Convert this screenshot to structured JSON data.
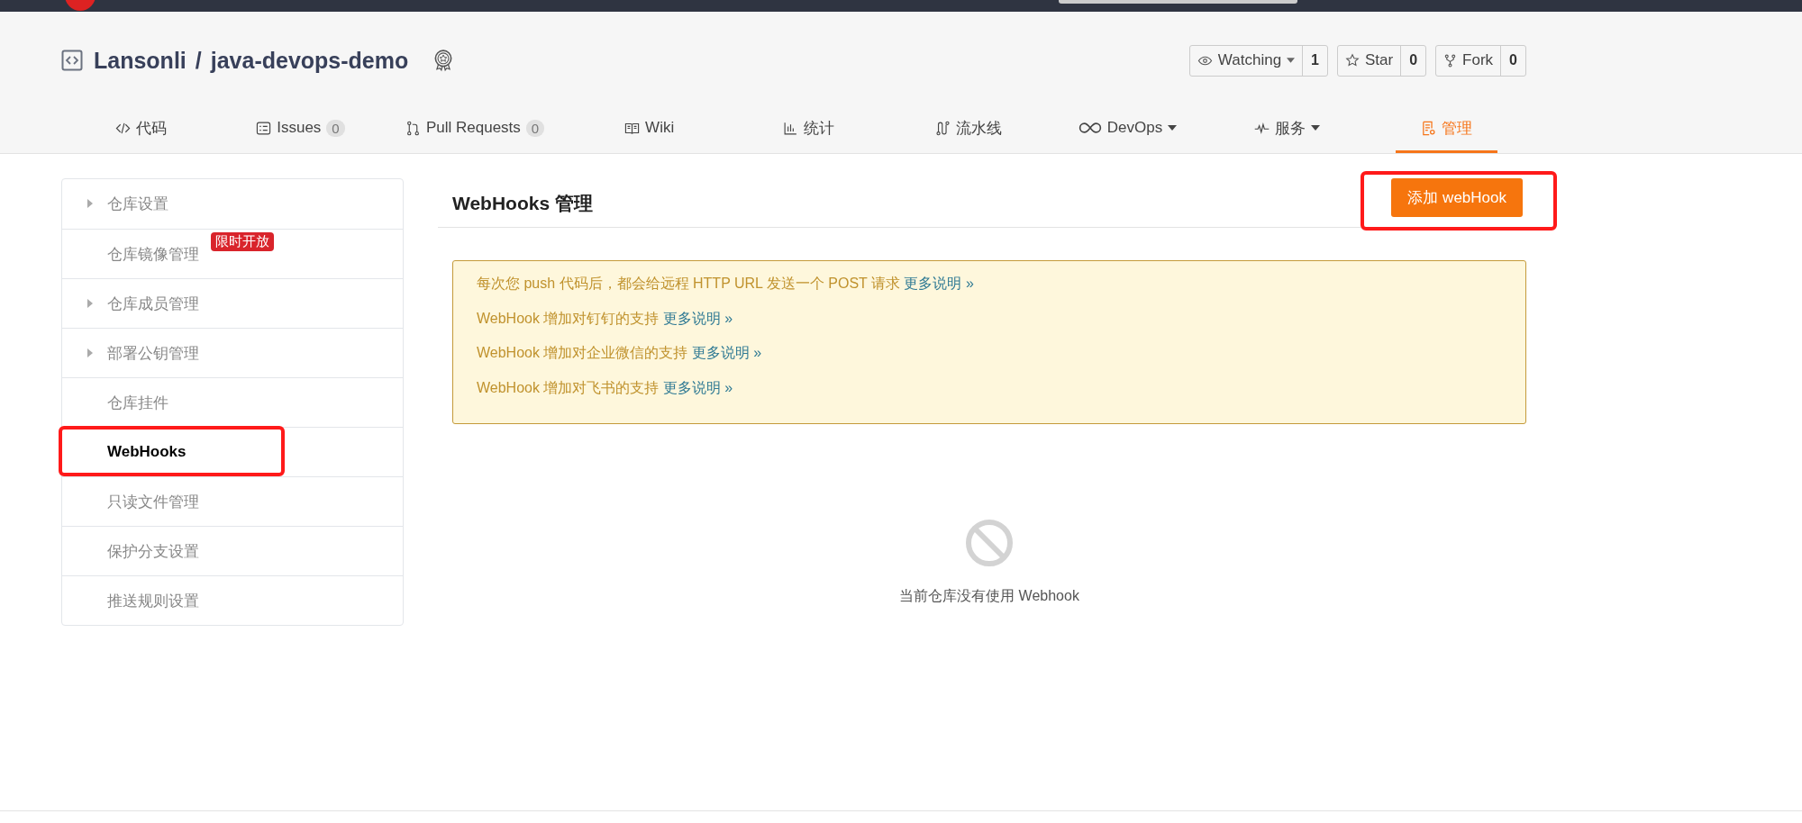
{
  "repo": {
    "owner": "Lansonli",
    "separator": "/",
    "name": "java-devops-demo"
  },
  "social": [
    {
      "kind": "watch",
      "label": "Watching",
      "dropdown": true,
      "count": "1"
    },
    {
      "kind": "star",
      "label": "Star",
      "dropdown": false,
      "count": "0"
    },
    {
      "kind": "fork",
      "label": "Fork",
      "dropdown": false,
      "count": "0"
    }
  ],
  "tabs": [
    {
      "kind": "code",
      "label": "代码",
      "selected": false
    },
    {
      "kind": "issues",
      "label": "Issues",
      "count": "0",
      "selected": false
    },
    {
      "kind": "pr",
      "label": "Pull Requests",
      "count": "0",
      "selected": false
    },
    {
      "kind": "book",
      "label": "Wiki",
      "selected": false
    },
    {
      "kind": "chart",
      "label": "统计",
      "selected": false
    },
    {
      "kind": "pipeline",
      "label": "流水线",
      "selected": false
    },
    {
      "kind": "infinity",
      "label": "DevOps",
      "dropdown": true,
      "selected": false
    },
    {
      "kind": "pulse",
      "label": "服务",
      "dropdown": true,
      "selected": false
    },
    {
      "kind": "doc",
      "label": "管理",
      "selected": true
    }
  ],
  "sidebar": {
    "items": [
      {
        "label": "仓库设置",
        "expandable": true,
        "selected": false
      },
      {
        "label": "仓库镜像管理",
        "badge": "限时开放",
        "expandable": false,
        "selected": false
      },
      {
        "label": "仓库成员管理",
        "expandable": true,
        "selected": false
      },
      {
        "label": "部署公钥管理",
        "expandable": true,
        "selected": false
      },
      {
        "label": "仓库挂件",
        "expandable": false,
        "selected": false
      },
      {
        "label": "WebHooks",
        "expandable": false,
        "selected": true,
        "annotated": true
      },
      {
        "label": "只读文件管理",
        "expandable": false,
        "selected": false
      },
      {
        "label": "保护分支设置",
        "expandable": false,
        "selected": false
      },
      {
        "label": "推送规则设置",
        "expandable": false,
        "selected": false
      }
    ]
  },
  "main": {
    "title": "WebHooks 管理",
    "add_button": {
      "label": "添加 webHook",
      "annotated": true
    },
    "notice": [
      {
        "text": "每次您 push 代码后，都会给远程 HTTP URL 发送一个 POST 请求",
        "link": "更多说明 »"
      },
      {
        "text": "WebHook 增加对钉钉的支持",
        "link": "更多说明 »"
      },
      {
        "text": "WebHook 增加对企业微信的支持",
        "link": "更多说明 »"
      },
      {
        "text": "WebHook 增加对飞书的支持",
        "link": "更多说明 »"
      }
    ],
    "empty_message": "当前仓库没有使用 Webhook"
  }
}
